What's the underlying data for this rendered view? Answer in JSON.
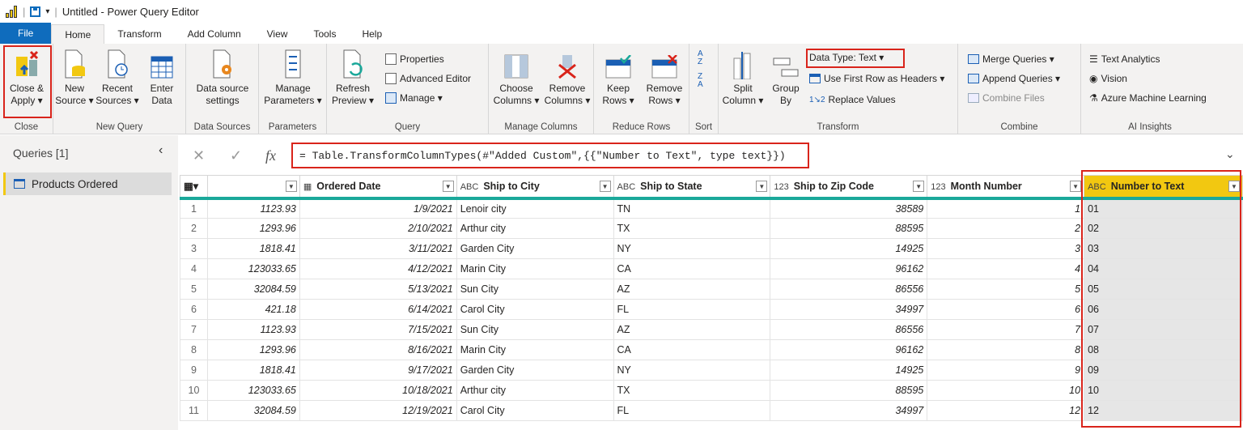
{
  "window": {
    "title": "Untitled - Power Query Editor"
  },
  "menu": {
    "tabs": [
      "File",
      "Home",
      "Transform",
      "Add Column",
      "View",
      "Tools",
      "Help"
    ]
  },
  "ribbon": {
    "close": {
      "btn": "Close &",
      "btn2": "Apply ▾",
      "label": "Close"
    },
    "newquery": {
      "new": "New",
      "new2": "Source ▾",
      "recent": "Recent",
      "recent2": "Sources ▾",
      "enter": "Enter",
      "enter2": "Data",
      "label": "New Query"
    },
    "datasources": {
      "btn": "Data source",
      "btn2": "settings",
      "label": "Data Sources"
    },
    "parameters": {
      "btn": "Manage",
      "btn2": "Parameters ▾",
      "label": "Parameters"
    },
    "query": {
      "refresh": "Refresh",
      "refresh2": "Preview ▾",
      "properties": "Properties",
      "advanced": "Advanced Editor",
      "manage": "Manage ▾",
      "label": "Query"
    },
    "managecols": {
      "choose": "Choose",
      "choose2": "Columns ▾",
      "remove": "Remove",
      "remove2": "Columns ▾",
      "label": "Manage Columns"
    },
    "reducerows": {
      "keep": "Keep",
      "keep2": "Rows ▾",
      "remove": "Remove",
      "remove2": "Rows ▾",
      "label": "Reduce Rows"
    },
    "sort": {
      "label": "Sort"
    },
    "transform": {
      "split": "Split",
      "split2": "Column ▾",
      "group": "Group",
      "group2": "By",
      "datatype": "Data Type: Text ▾",
      "firstrow": "Use First Row as Headers ▾",
      "replace": "Replace Values",
      "label": "Transform"
    },
    "combine": {
      "merge": "Merge Queries ▾",
      "append": "Append Queries ▾",
      "combinefiles": "Combine Files",
      "label": "Combine"
    },
    "ai": {
      "text": "Text Analytics",
      "vision": "Vision",
      "azure": "Azure Machine Learning",
      "label": "AI Insights"
    }
  },
  "queries": {
    "header": "Queries [1]",
    "items": [
      "Products Ordered"
    ]
  },
  "formula": {
    "text": "= Table.TransformColumnTypes(#\"Added Custom\",{{\"Number to Text\", type text}})"
  },
  "table": {
    "columns": [
      {
        "type": "",
        "name": ""
      },
      {
        "type": "▦",
        "name": "Ordered Date"
      },
      {
        "type": "ABC",
        "name": "Ship to City"
      },
      {
        "type": "ABC",
        "name": "Ship to State"
      },
      {
        "type": "123",
        "name": "Ship to Zip Code"
      },
      {
        "type": "123",
        "name": "Month Number"
      },
      {
        "type": "ABC",
        "name": "Number to Text"
      }
    ],
    "rows": [
      [
        "1",
        "1123.93",
        "1/9/2021",
        "Lenoir city",
        "TN",
        "38589",
        "1",
        "01"
      ],
      [
        "2",
        "1293.96",
        "2/10/2021",
        "Arthur city",
        "TX",
        "88595",
        "2",
        "02"
      ],
      [
        "3",
        "1818.41",
        "3/11/2021",
        "Garden City",
        "NY",
        "14925",
        "3",
        "03"
      ],
      [
        "4",
        "123033.65",
        "4/12/2021",
        "Marin City",
        "CA",
        "96162",
        "4",
        "04"
      ],
      [
        "5",
        "32084.59",
        "5/13/2021",
        "Sun City",
        "AZ",
        "86556",
        "5",
        "05"
      ],
      [
        "6",
        "421.18",
        "6/14/2021",
        "Carol City",
        "FL",
        "34997",
        "6",
        "06"
      ],
      [
        "7",
        "1123.93",
        "7/15/2021",
        "Sun City",
        "AZ",
        "86556",
        "7",
        "07"
      ],
      [
        "8",
        "1293.96",
        "8/16/2021",
        "Marin City",
        "CA",
        "96162",
        "8",
        "08"
      ],
      [
        "9",
        "1818.41",
        "9/17/2021",
        "Garden City",
        "NY",
        "14925",
        "9",
        "09"
      ],
      [
        "10",
        "123033.65",
        "10/18/2021",
        "Arthur city",
        "TX",
        "88595",
        "10",
        "10"
      ],
      [
        "11",
        "32084.59",
        "12/19/2021",
        "Carol City",
        "FL",
        "34997",
        "12",
        "12"
      ]
    ]
  },
  "colors": {
    "accent": "#f2c811",
    "file": "#0f6cbd",
    "highlight": "#d9241b",
    "teal": "#1aa89a"
  }
}
